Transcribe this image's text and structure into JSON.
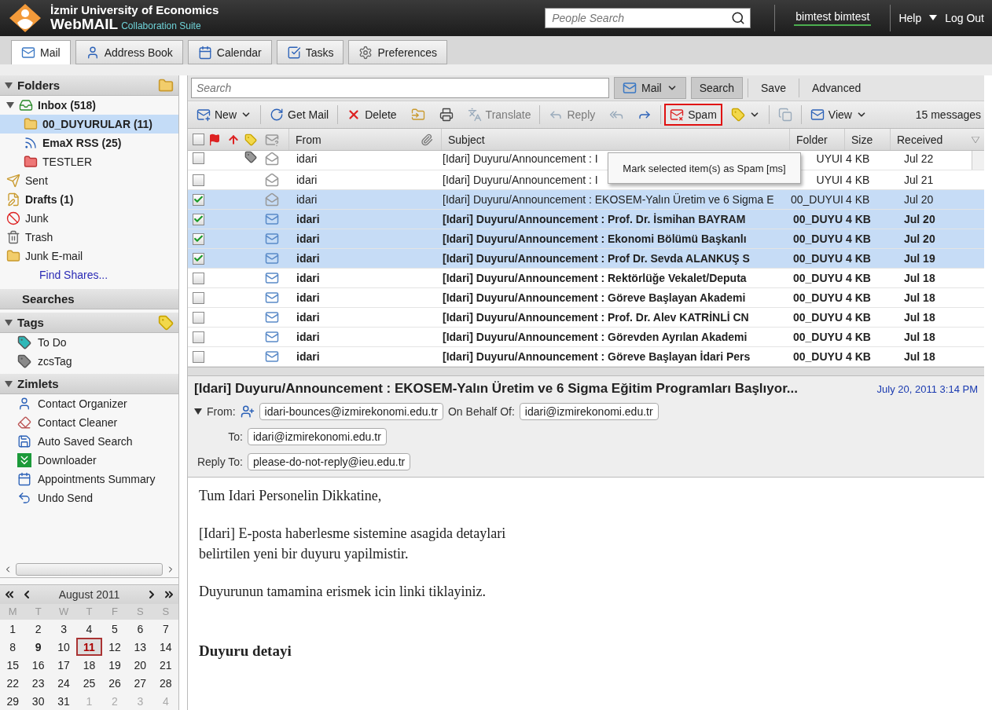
{
  "header": {
    "brand_line1": "İzmir University of Economics",
    "brand_line2": "WebMAIL",
    "brand_tagline": "Collaboration Suite",
    "people_search": {
      "placeholder": "People Search"
    },
    "user": "bimtest bimtest",
    "help": "Help",
    "logout": "Log Out"
  },
  "app_tabs": [
    {
      "label": "Mail",
      "kind": "mail",
      "selected": true
    },
    {
      "label": "Address Book",
      "kind": "contacts",
      "selected": false
    },
    {
      "label": "Calendar",
      "kind": "calendar",
      "selected": false
    },
    {
      "label": "Tasks",
      "kind": "tasks",
      "selected": false
    },
    {
      "label": "Preferences",
      "kind": "prefs",
      "selected": false
    }
  ],
  "sidebar": {
    "folders_title": "Folders",
    "folders": [
      {
        "label": "Inbox (518)",
        "kind": "inbox",
        "bold": true,
        "selected": false,
        "expanded": true,
        "children": [
          {
            "label": "00_DUYURULAR (11)",
            "kind": "folder",
            "bold": true,
            "selected": true
          },
          {
            "label": "EmaX RSS (25)",
            "kind": "rss",
            "bold": true,
            "selected": false
          },
          {
            "label": "TESTLER",
            "kind": "redfolder",
            "bold": false,
            "selected": false
          }
        ]
      },
      {
        "label": "Sent",
        "kind": "sent",
        "bold": false,
        "selected": false
      },
      {
        "label": "Drafts (1)",
        "kind": "drafts",
        "bold": true,
        "selected": false
      },
      {
        "label": "Junk",
        "kind": "junk",
        "bold": false,
        "selected": false
      },
      {
        "label": "Trash",
        "kind": "trash",
        "bold": false,
        "selected": false
      },
      {
        "label": "Junk E-mail",
        "kind": "folder",
        "bold": false,
        "selected": false
      }
    ],
    "find_shares": "Find Shares...",
    "searches_title": "Searches",
    "tags_title": "Tags",
    "tags": [
      {
        "label": "To Do",
        "color": "#2fb8b8"
      },
      {
        "label": "zcsTag",
        "color": "#8a8a8a"
      }
    ],
    "zimlets_title": "Zimlets",
    "zimlets": [
      {
        "label": "Contact Organizer",
        "kind": "person"
      },
      {
        "label": "Contact Cleaner",
        "kind": "eraser"
      },
      {
        "label": "Auto Saved Search",
        "kind": "disk"
      },
      {
        "label": "Downloader",
        "kind": "download"
      },
      {
        "label": "Appointments Summary",
        "kind": "calendar"
      },
      {
        "label": "Undo Send",
        "kind": "undo"
      }
    ],
    "calendar": {
      "title": "August 2011",
      "weekdays": [
        "M",
        "T",
        "W",
        "T",
        "F",
        "S",
        "S"
      ],
      "weeks": [
        [
          {
            "d": "1",
            "other": false,
            "today": false,
            "bold": false
          },
          {
            "d": "2",
            "other": false,
            "today": false,
            "bold": false
          },
          {
            "d": "3",
            "other": false,
            "today": false,
            "bold": false
          },
          {
            "d": "4",
            "other": false,
            "today": false,
            "bold": false
          },
          {
            "d": "5",
            "other": false,
            "today": false,
            "bold": false
          },
          {
            "d": "6",
            "other": false,
            "today": false,
            "bold": false
          },
          {
            "d": "7",
            "other": false,
            "today": false,
            "bold": false
          }
        ],
        [
          {
            "d": "8",
            "other": false,
            "today": false,
            "bold": false
          },
          {
            "d": "9",
            "other": false,
            "today": false,
            "bold": true
          },
          {
            "d": "10",
            "other": false,
            "today": false,
            "bold": false
          },
          {
            "d": "11",
            "other": false,
            "today": true,
            "bold": true
          },
          {
            "d": "12",
            "other": false,
            "today": false,
            "bold": false
          },
          {
            "d": "13",
            "other": false,
            "today": false,
            "bold": false
          },
          {
            "d": "14",
            "other": false,
            "today": false,
            "bold": false
          }
        ],
        [
          {
            "d": "15",
            "other": false,
            "today": false,
            "bold": false
          },
          {
            "d": "16",
            "other": false,
            "today": false,
            "bold": false
          },
          {
            "d": "17",
            "other": false,
            "today": false,
            "bold": false
          },
          {
            "d": "18",
            "other": false,
            "today": false,
            "bold": false
          },
          {
            "d": "19",
            "other": false,
            "today": false,
            "bold": false
          },
          {
            "d": "20",
            "other": false,
            "today": false,
            "bold": false
          },
          {
            "d": "21",
            "other": false,
            "today": false,
            "bold": false
          }
        ],
        [
          {
            "d": "22",
            "other": false,
            "today": false,
            "bold": false
          },
          {
            "d": "23",
            "other": false,
            "today": false,
            "bold": false
          },
          {
            "d": "24",
            "other": false,
            "today": false,
            "bold": false
          },
          {
            "d": "25",
            "other": false,
            "today": false,
            "bold": false
          },
          {
            "d": "26",
            "other": false,
            "today": false,
            "bold": false
          },
          {
            "d": "27",
            "other": false,
            "today": false,
            "bold": false
          },
          {
            "d": "28",
            "other": false,
            "today": false,
            "bold": false
          }
        ],
        [
          {
            "d": "29",
            "other": false,
            "today": false,
            "bold": false
          },
          {
            "d": "30",
            "other": false,
            "today": false,
            "bold": false
          },
          {
            "d": "31",
            "other": false,
            "today": false,
            "bold": false
          },
          {
            "d": "1",
            "other": true,
            "today": false,
            "bold": false
          },
          {
            "d": "2",
            "other": true,
            "today": false,
            "bold": false
          },
          {
            "d": "3",
            "other": true,
            "today": false,
            "bold": false
          },
          {
            "d": "4",
            "other": true,
            "today": false,
            "bold": false
          }
        ]
      ]
    }
  },
  "search_bar": {
    "placeholder": "Search",
    "scope": "Mail",
    "search": "Search",
    "save": "Save",
    "advanced": "Advanced"
  },
  "toolbar": [
    {
      "kind": "new",
      "label": "New",
      "menu": true,
      "disabled": false,
      "highlighted": false
    },
    {
      "kind": "sep"
    },
    {
      "kind": "getmail",
      "label": "Get Mail",
      "menu": false,
      "disabled": false,
      "highlighted": false
    },
    {
      "kind": "sep"
    },
    {
      "kind": "delete",
      "label": "Delete",
      "menu": false,
      "disabled": false,
      "highlighted": false
    },
    {
      "kind": "move",
      "menu": false,
      "disabled": false,
      "highlighted": false
    },
    {
      "kind": "print",
      "menu": false,
      "disabled": false,
      "highlighted": false
    },
    {
      "kind": "translate",
      "label": "Translate",
      "menu": false,
      "disabled": true,
      "highlighted": false
    },
    {
      "kind": "sep"
    },
    {
      "kind": "reply",
      "label": "Reply",
      "menu": false,
      "disabled": true,
      "highlighted": false
    },
    {
      "kind": "replyall",
      "menu": false,
      "disabled": true,
      "highlighted": false
    },
    {
      "kind": "forward",
      "menu": false,
      "disabled": false,
      "highlighted": false
    },
    {
      "kind": "sep"
    },
    {
      "kind": "spam",
      "label": "Spam",
      "menu": false,
      "disabled": false,
      "highlighted": true
    },
    {
      "kind": "tag",
      "menu": true,
      "disabled": false,
      "highlighted": false
    },
    {
      "kind": "sep"
    },
    {
      "kind": "window",
      "menu": false,
      "disabled": true,
      "highlighted": false
    },
    {
      "kind": "sep"
    },
    {
      "kind": "view",
      "label": "View",
      "menu": true,
      "disabled": false,
      "highlighted": false
    }
  ],
  "message_count": "15 messages",
  "tooltip": "Mark selected item(s) as Spam [ms]",
  "columns": {
    "select_all_checked": false,
    "from": "From",
    "subject": "Subject",
    "folder": "Folder",
    "size": "Size",
    "received": "Received"
  },
  "messages": [
    {
      "checked": false,
      "unread": false,
      "tagged": true,
      "from": "idari",
      "subject": "[Idari] Duyuru/Announcement : I",
      "folder": "UYUI",
      "size": "4 KB",
      "received": "Jul 22"
    },
    {
      "checked": false,
      "unread": false,
      "tagged": false,
      "from": "idari",
      "subject": "[Idari] Duyuru/Announcement : I",
      "folder": "UYUI",
      "size": "4 KB",
      "received": "Jul 21"
    },
    {
      "checked": true,
      "unread": false,
      "tagged": false,
      "from": "idari",
      "subject": "[Idari] Duyuru/Announcement : EKOSEM-Yalın Üretim ve 6 Sigma E",
      "folder": "00_DUYUI",
      "size": "4 KB",
      "received": "Jul 20"
    },
    {
      "checked": true,
      "unread": true,
      "tagged": false,
      "from": "idari",
      "subject": "[Idari] Duyuru/Announcement : Prof. Dr. İsmihan BAYRAM",
      "folder": "00_DUYU",
      "size": "4 KB",
      "received": "Jul 20"
    },
    {
      "checked": true,
      "unread": true,
      "tagged": false,
      "from": "idari",
      "subject": "[Idari] Duyuru/Announcement : Ekonomi Bölümü Başkanlı",
      "folder": "00_DUYU",
      "size": "4 KB",
      "received": "Jul 20"
    },
    {
      "checked": true,
      "unread": true,
      "tagged": false,
      "from": "idari",
      "subject": "[Idari] Duyuru/Announcement : Prof Dr. Sevda ALANKUŞ S",
      "folder": "00_DUYU",
      "size": "4 KB",
      "received": "Jul 19"
    },
    {
      "checked": false,
      "unread": true,
      "tagged": false,
      "from": "idari",
      "subject": "[Idari] Duyuru/Announcement : Rektörlüğe Vekalet/Deputa",
      "folder": "00_DUYU",
      "size": "4 KB",
      "received": "Jul 18"
    },
    {
      "checked": false,
      "unread": true,
      "tagged": false,
      "from": "idari",
      "subject": "[Idari] Duyuru/Announcement : Göreve Başlayan Akademi",
      "folder": "00_DUYU",
      "size": "4 KB",
      "received": "Jul 18"
    },
    {
      "checked": false,
      "unread": true,
      "tagged": false,
      "from": "idari",
      "subject": "[Idari] Duyuru/Announcement : Prof. Dr. Alev KATRİNLİ CN",
      "folder": "00_DUYU",
      "size": "4 KB",
      "received": "Jul 18"
    },
    {
      "checked": false,
      "unread": true,
      "tagged": false,
      "from": "idari",
      "subject": "[Idari] Duyuru/Announcement : Görevden Ayrılan Akademi",
      "folder": "00_DUYU",
      "size": "4 KB",
      "received": "Jul 18"
    },
    {
      "checked": false,
      "unread": true,
      "tagged": false,
      "from": "idari",
      "subject": "[Idari] Duyuru/Announcement : Göreve Başlayan İdari Pers",
      "folder": "00_DUYU",
      "size": "4 KB",
      "received": "Jul 18"
    }
  ],
  "reading_pane": {
    "subject": "[Idari] Duyuru/Announcement : EKOSEM-Yalın Üretim ve 6 Sigma Eğitim Programları Başlıyor...",
    "date": "July 20, 2011 3:14 PM",
    "from_label": "From:",
    "from": "idari-bounces@izmirekonomi.edu.tr",
    "behalf_label": "On Behalf Of:",
    "behalf": "idari@izmirekonomi.edu.tr",
    "to_label": "To:",
    "to": "idari@izmirekonomi.edu.tr",
    "reply_label": "Reply To:",
    "reply_to": "please-do-not-reply@ieu.edu.tr",
    "body": [
      {
        "kind": "para",
        "text": "Tum Idari Personelin Dikkatine,"
      },
      {
        "kind": "para",
        "text": "[Idari] E-posta haberlesme sistemine asagida detaylari\nbelirtilen yeni bir duyuru yapilmistir."
      },
      {
        "kind": "para",
        "text": "Duyurunun tamamina erismek icin linki tiklayiniz."
      },
      {
        "kind": "heading",
        "text": "Duyuru detayi"
      }
    ]
  }
}
